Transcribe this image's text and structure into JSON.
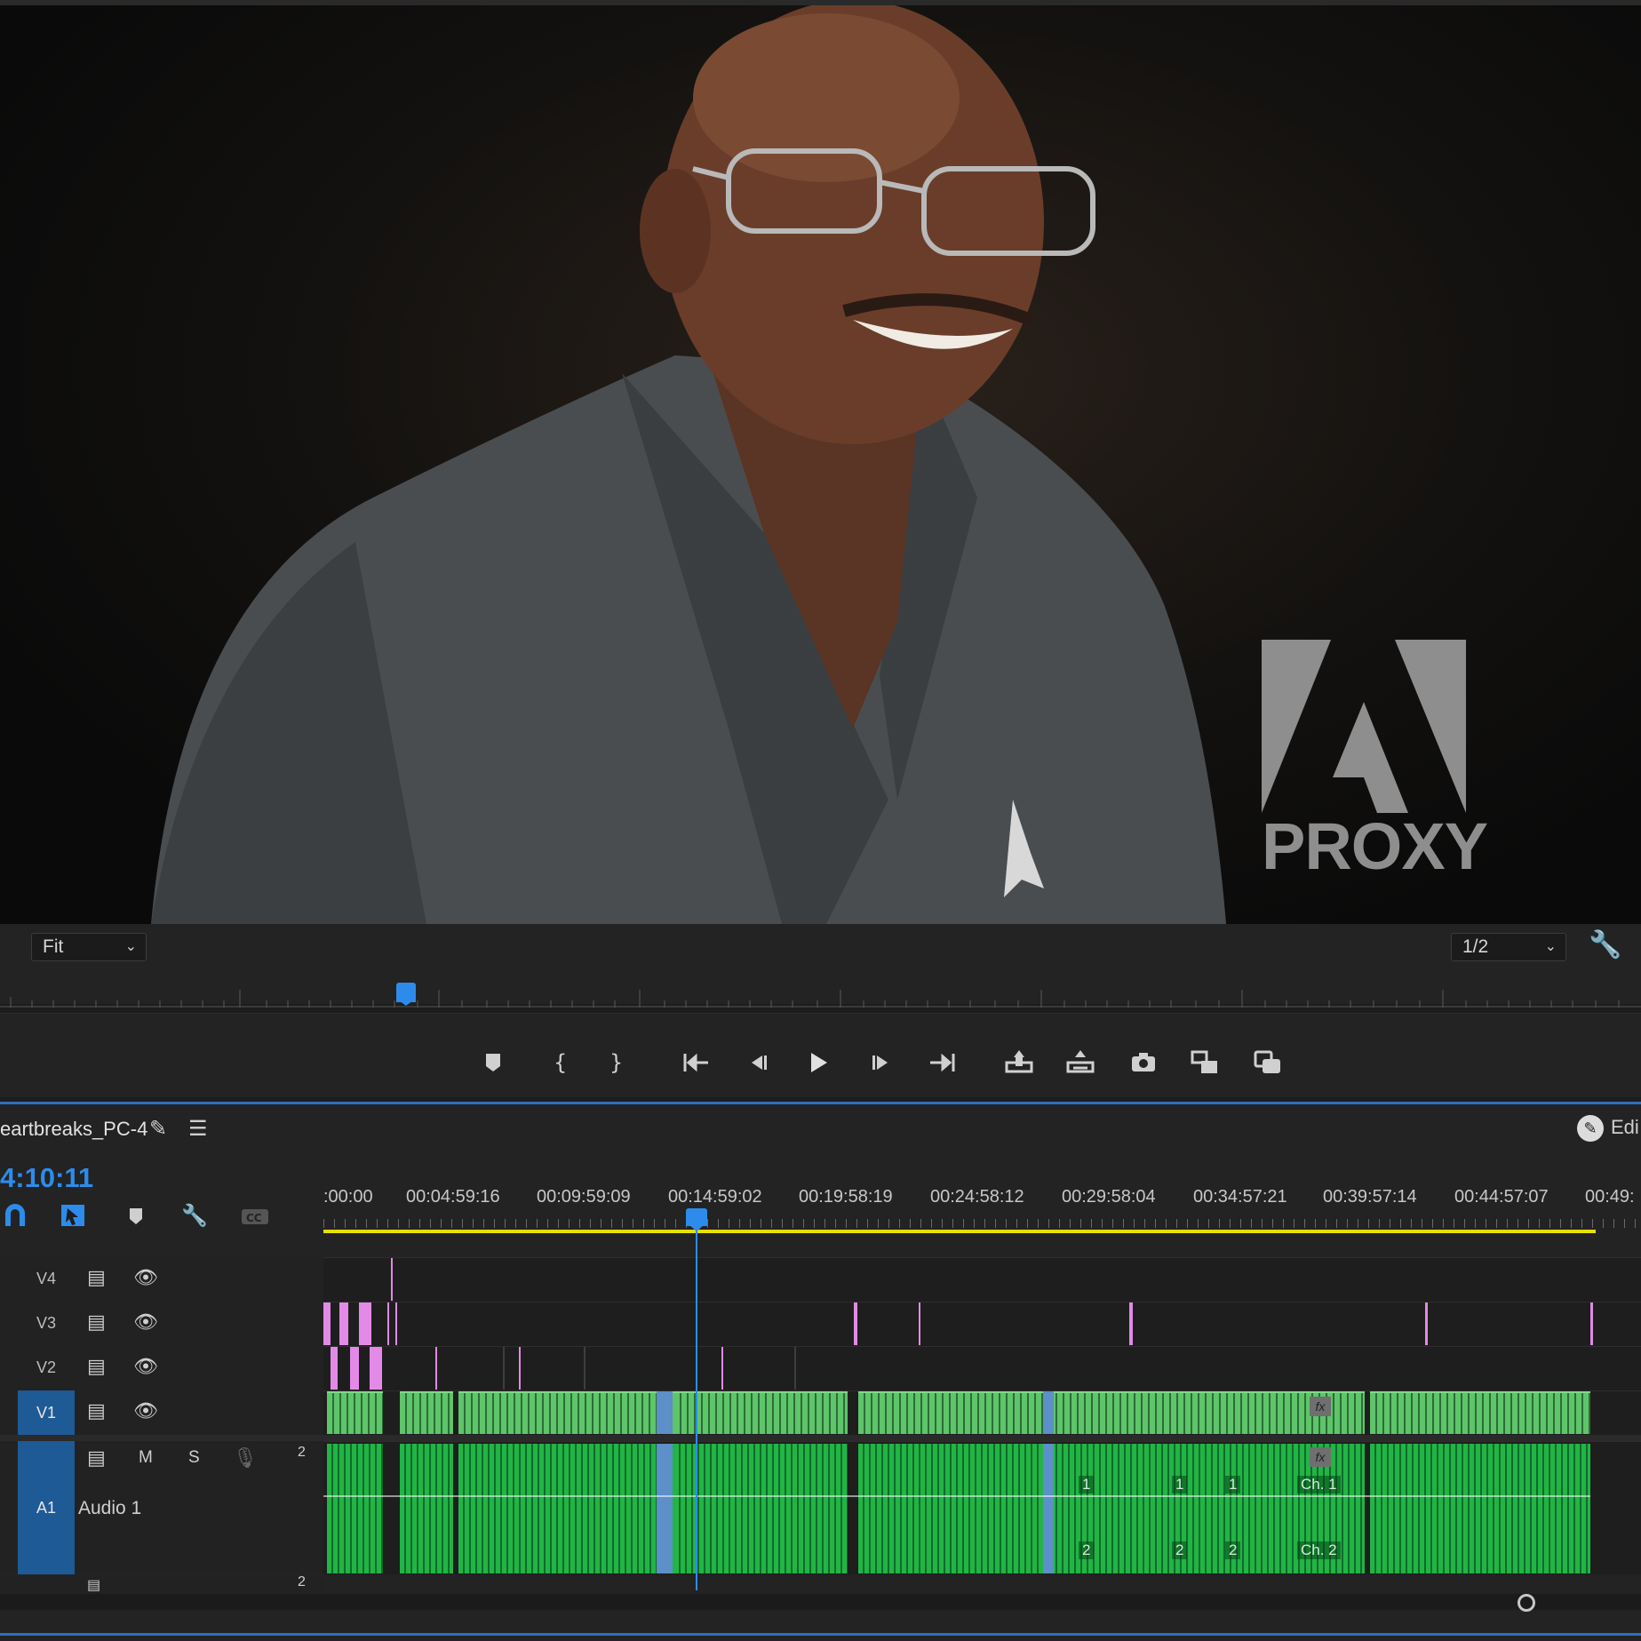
{
  "program_monitor": {
    "watermark_text": "PROXY",
    "zoom_select": "Fit",
    "resolution_select": "1/2",
    "image_description_icon": "person-portrait"
  },
  "transport": {
    "buttons": [
      "add-marker",
      "mark-in",
      "mark-out",
      "go-to-in",
      "step-back",
      "play",
      "step-forward",
      "go-to-out",
      "lift",
      "extract",
      "export-frame",
      "insert",
      "overwrite"
    ]
  },
  "timeline": {
    "sequence_name": "eartbreaks_PC-4",
    "edit_label": "Edi",
    "timecode": "4:10:11",
    "ruler_labels": [
      ":00:00",
      "00:04:59:16",
      "00:09:59:09",
      "00:14:59:02",
      "00:19:58:19",
      "00:24:58:12",
      "00:29:58:04",
      "00:34:57:21",
      "00:39:57:14",
      "00:44:57:07",
      "00:49:"
    ],
    "tracks": {
      "v4": "V4",
      "v3": "V3",
      "v2": "V2",
      "v1": "V1",
      "a1": "A1",
      "a1_name": "Audio 1",
      "a1_m": "M",
      "a1_s": "S",
      "a1_channels": "2",
      "a2_channels": "2"
    },
    "clip_labels": {
      "ch1": "Ch. 1",
      "ch2": "Ch. 2",
      "one": "1",
      "two": "2",
      "fx": "fx"
    }
  },
  "colors": {
    "accent": "#2d8ceb",
    "video_clip": "#5fc46a",
    "audio_clip": "#22b445",
    "graphics_clip": "#e08ae6",
    "work_area": "#e8e000"
  }
}
